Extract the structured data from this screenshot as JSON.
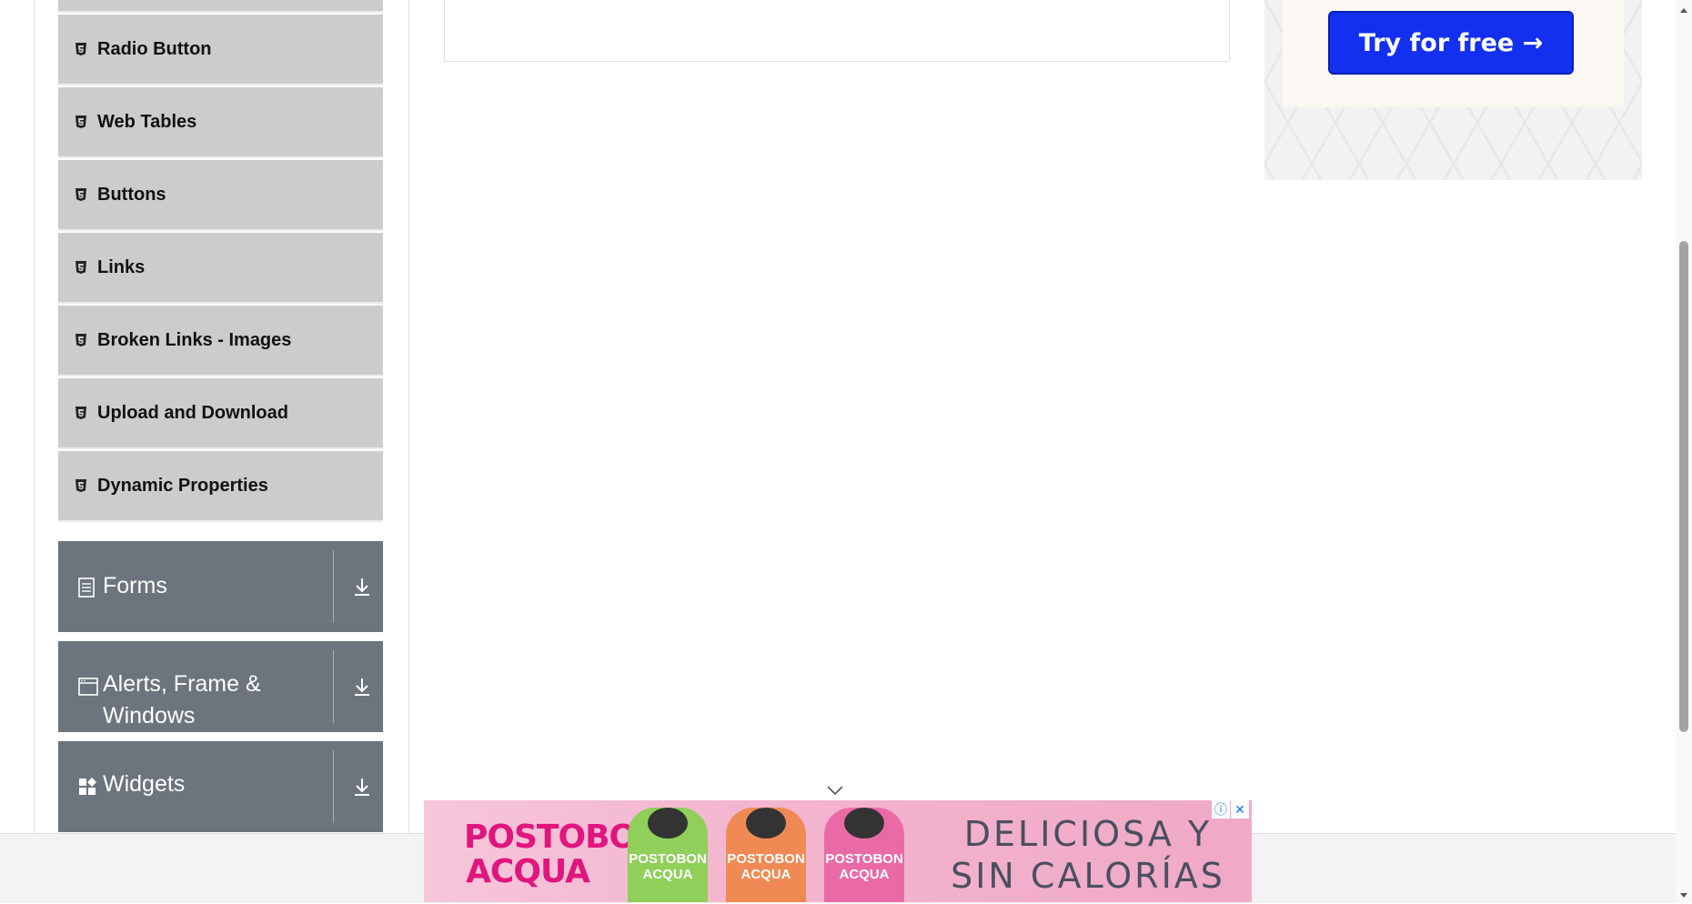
{
  "sidebar": {
    "elements_items": [
      {
        "label": "Radio Button",
        "icon": "html5-icon"
      },
      {
        "label": "Web Tables",
        "icon": "html5-icon"
      },
      {
        "label": "Buttons",
        "icon": "html5-icon"
      },
      {
        "label": "Links",
        "icon": "html5-icon"
      },
      {
        "label": "Broken Links - Images",
        "icon": "html5-icon"
      },
      {
        "label": "Upload and Download",
        "icon": "html5-icon"
      },
      {
        "label": "Dynamic Properties",
        "icon": "html5-icon"
      }
    ],
    "groups": [
      {
        "label": "Forms",
        "icon": "document-icon"
      },
      {
        "label": "Alerts, Frame & Windows",
        "icon": "window-icon"
      },
      {
        "label": "Widgets",
        "icon": "widgets-icon"
      }
    ]
  },
  "ad_right": {
    "cta_label": "Try for free →",
    "button_color": "#1330f0"
  },
  "banner_ad": {
    "brand": "POSTOBON ACQUA",
    "bottles": [
      {
        "label": "POSTOBON ACQUA",
        "color": "#8fcf5a"
      },
      {
        "label": "POSTOBON ACQUA",
        "color": "#f08a55"
      },
      {
        "label": "POSTOBON ACQUA",
        "color": "#ea6aa6"
      }
    ],
    "tagline": "DELICIOSA Y SIN CALORÍAS",
    "info_icon": "ⓘ",
    "close_icon": "✕"
  },
  "colors": {
    "menu_item_bg": "#cccccc",
    "group_header_bg": "#6c757d"
  }
}
